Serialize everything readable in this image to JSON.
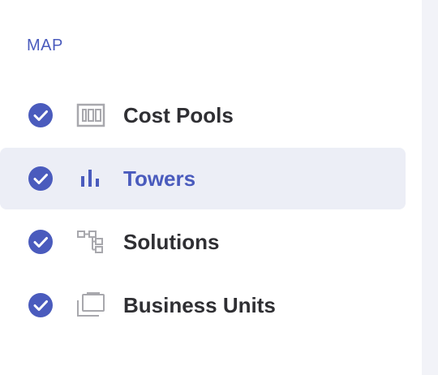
{
  "section": {
    "title": "MAP"
  },
  "colors": {
    "accent": "#4a5bbd",
    "active_bg": "#eceef6",
    "text": "#2f2f33",
    "icon_gray": "#a8a8ad",
    "right_strip": "#f2f3f8"
  },
  "nav": {
    "items": [
      {
        "label": "Cost Pools",
        "icon": "cost-pools-icon",
        "status": "complete-check-icon"
      },
      {
        "label": "Towers",
        "icon": "bar-chart-icon",
        "status": "complete-check-icon",
        "active": true
      },
      {
        "label": "Solutions",
        "icon": "hierarchy-icon",
        "status": "complete-check-icon"
      },
      {
        "label": "Business Units",
        "icon": "briefcase-icon",
        "status": "complete-check-icon"
      }
    ]
  }
}
